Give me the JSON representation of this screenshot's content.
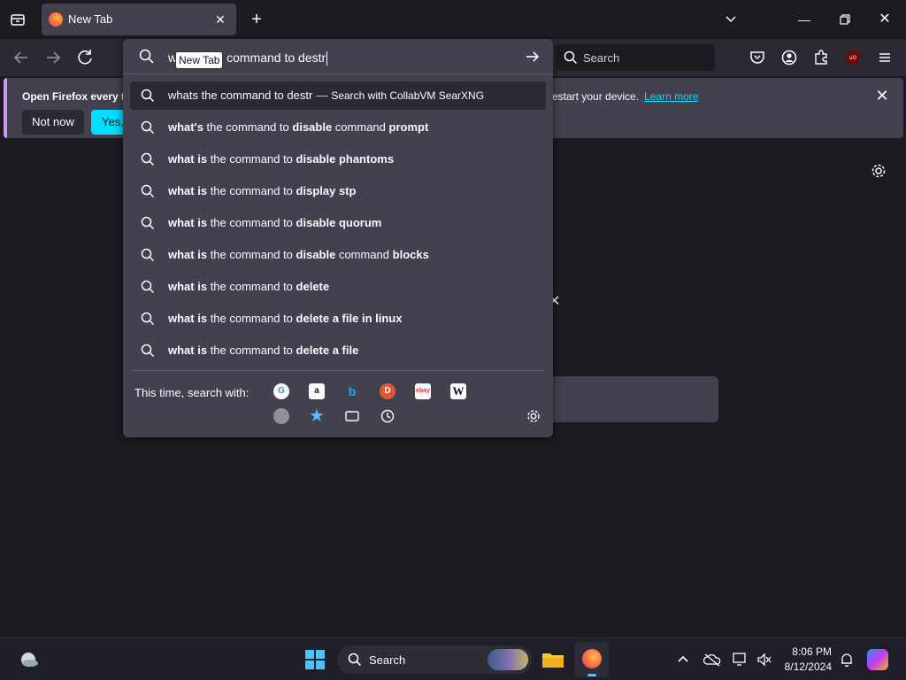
{
  "tab": {
    "title": "New Tab"
  },
  "toolbar": {
    "search_placeholder": "Search"
  },
  "notification": {
    "message": "Open Firefox every ti",
    "message_rest": "estart your device.",
    "learn_more": "Learn more",
    "not_now": "Not now",
    "yes": "Yes, c"
  },
  "urlbar": {
    "typed_prefix": "w",
    "tooltip": "New Tab",
    "typed_suffix": "command to destr",
    "suggestions": [
      {
        "plain": "whats the command to destr",
        "action": "Search with CollabVM SearXNG"
      },
      {
        "parts": [
          "what's",
          " the command to ",
          "disable",
          " command ",
          "prompt"
        ]
      },
      {
        "parts": [
          "what is",
          " the command to ",
          "disable phantoms",
          "",
          ""
        ]
      },
      {
        "parts": [
          "what is",
          " the command to ",
          "display stp",
          "",
          ""
        ]
      },
      {
        "parts": [
          "what is",
          " the command to ",
          "disable quorum",
          "",
          ""
        ]
      },
      {
        "parts": [
          "what is",
          " the command to ",
          "disable",
          " command ",
          "blocks"
        ]
      },
      {
        "parts": [
          "what is",
          " the command to ",
          "delete",
          "",
          ""
        ]
      },
      {
        "parts": [
          "what is",
          " the command to ",
          "delete a file in linux",
          "",
          ""
        ]
      },
      {
        "parts": [
          "what is",
          " the command to ",
          "delete a file",
          "",
          ""
        ]
      }
    ],
    "engines_label": "This time, search with:",
    "engines": [
      "Google",
      "Amazon",
      "Bing",
      "DuckDuckGo",
      "eBay",
      "Wikipedia",
      "CollabVM SearXNG",
      "Bookmarks",
      "Tabs",
      "History"
    ]
  },
  "taskbar": {
    "search_label": "Search",
    "time": "8:06 PM",
    "date": "8/12/2024"
  },
  "icons": [
    "tab-list-icon",
    "firefox-icon",
    "close-icon",
    "plus-icon",
    "chevron-down-icon",
    "minimize-icon",
    "restore-icon",
    "back-icon",
    "forward-icon",
    "reload-icon",
    "search-icon",
    "arrow-right-icon",
    "pocket-icon",
    "account-icon",
    "extensions-icon",
    "ublock-icon",
    "menu-icon",
    "gear-icon",
    "weather-icon",
    "windows-start-icon",
    "file-explorer-icon",
    "chevron-up-icon",
    "onedrive-icon",
    "network-icon",
    "volume-icon",
    "bell-icon",
    "copilot-icon"
  ]
}
